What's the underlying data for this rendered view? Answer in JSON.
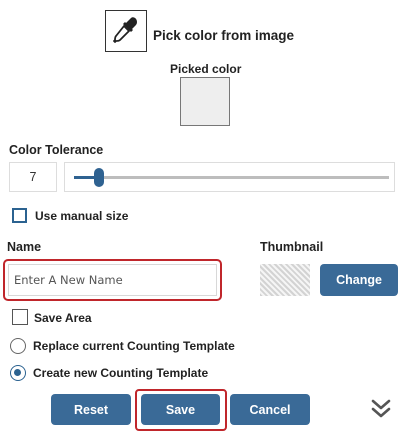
{
  "picker": {
    "label": "Pick color from image",
    "icon": "eyedropper-icon"
  },
  "picked": {
    "label": "Picked color",
    "color": "#eeeeee"
  },
  "tolerance": {
    "label": "Color Tolerance",
    "value": "7",
    "slider_fraction": 0.08
  },
  "manual_size": {
    "label": "Use manual size",
    "checked": false
  },
  "name": {
    "label": "Name",
    "placeholder": "Enter A New Name"
  },
  "thumbnail": {
    "label": "Thumbnail",
    "change_label": "Change"
  },
  "save_area": {
    "label": "Save Area",
    "checked": false
  },
  "template_options": {
    "replace_label": "Replace current Counting Template",
    "create_label": "Create new Counting Template",
    "selected": "create"
  },
  "actions": {
    "reset_label": "Reset",
    "save_label": "Save",
    "cancel_label": "Cancel",
    "collapse_icon": "double-chevron-down-icon"
  },
  "colors": {
    "accent": "#3a6a97",
    "highlight": "#c0262b"
  }
}
